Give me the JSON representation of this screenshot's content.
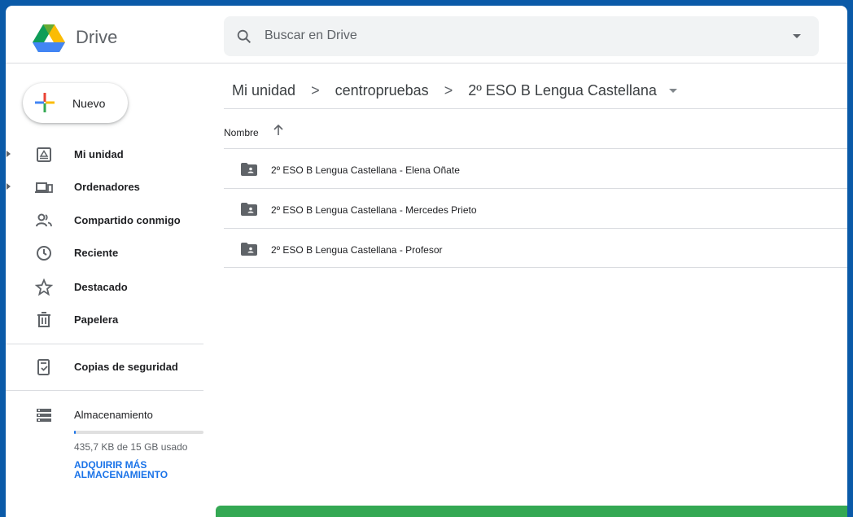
{
  "app": {
    "name": "Drive"
  },
  "search": {
    "placeholder": "Buscar en Drive"
  },
  "new_button": {
    "label": "Nuevo"
  },
  "sidebar": {
    "items": [
      {
        "label": "Mi unidad",
        "icon": "my-drive-icon"
      },
      {
        "label": "Ordenadores",
        "icon": "computers-icon"
      },
      {
        "label": "Compartido conmigo",
        "icon": "shared-icon"
      },
      {
        "label": "Reciente",
        "icon": "clock-icon"
      },
      {
        "label": "Destacado",
        "icon": "star-icon"
      },
      {
        "label": "Papelera",
        "icon": "trash-icon"
      },
      {
        "label": "Copias de seguridad",
        "icon": "backup-icon"
      },
      {
        "label": "Almacenamiento",
        "icon": "storage-icon"
      }
    ],
    "storage": {
      "used_text": "435,7 KB de 15 GB usado",
      "buy_label": "ADQUIRIR MÁS ALMACENAMIENTO",
      "used_fraction": 0.01
    }
  },
  "breadcrumb": [
    "Mi unidad",
    "centropruebas",
    "2º ESO B Lengua Castellana"
  ],
  "list": {
    "column_header": "Nombre",
    "sort": "ascending",
    "rows": [
      {
        "name": "2º ESO B Lengua Castellana - Elena Oñate"
      },
      {
        "name": "2º ESO B Lengua Castellana - Mercedes Prieto"
      },
      {
        "name": "2º ESO B Lengua Castellana - Profesor"
      }
    ]
  },
  "colors": {
    "accent": "#1a73e8",
    "frame": "#0a5aa8",
    "toast": "#34a853"
  }
}
